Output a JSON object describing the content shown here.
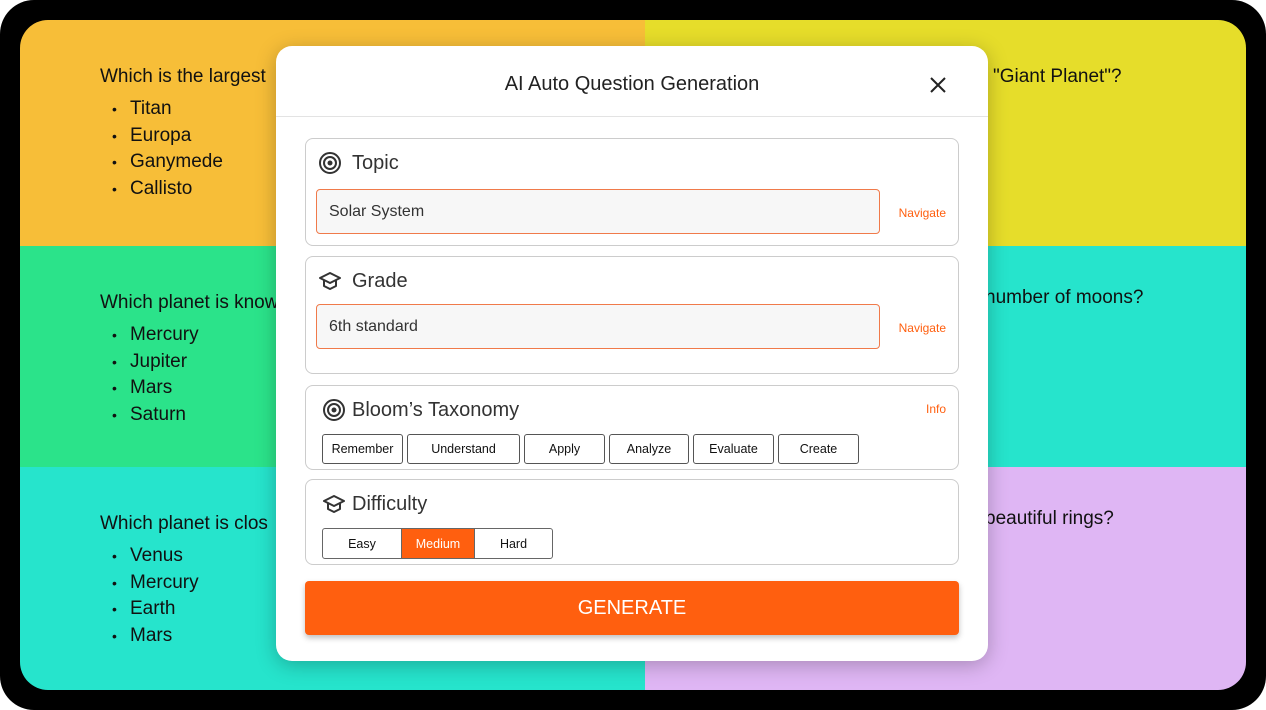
{
  "background_questions": [
    {
      "question": "Which is the largest",
      "options": [
        "Titan",
        "Europa",
        "Ganymede",
        "Callisto"
      ],
      "color": "#F7BE38"
    },
    {
      "question": "\"Giant Planet\"?",
      "options": [],
      "color": "#E6DD2A"
    },
    {
      "question": "Which planet is know",
      "options": [
        "Mercury",
        "Jupiter",
        "Mars",
        "Saturn"
      ],
      "color": "#2BE38A"
    },
    {
      "question": "number of moons?",
      "options": [],
      "color": "#26E4CC"
    },
    {
      "question": "Which planet is clos",
      "options": [
        "Venus",
        "Mercury",
        "Earth",
        "Mars"
      ],
      "color": "#26E4CC"
    },
    {
      "question": "beautiful rings?",
      "options": [],
      "color": "#DFB6F4"
    }
  ],
  "modal": {
    "title": "AI Auto Question Generation",
    "close_icon": "close-icon",
    "topic": {
      "label": "Topic",
      "value": "Solar System",
      "link": "Navigate"
    },
    "grade": {
      "label": "Grade",
      "value": "6th standard",
      "link": "Navigate"
    },
    "bloom": {
      "label": "Bloom’s Taxonomy",
      "info": "Info",
      "options": [
        "Remember",
        "Understand",
        "Apply",
        "Analyze",
        "Evaluate",
        "Create"
      ]
    },
    "difficulty": {
      "label": "Difficulty",
      "options": [
        "Easy",
        "Medium",
        "Hard"
      ],
      "selected": "Medium"
    },
    "generate": "GENERATE"
  },
  "accent": "#FF5F0F"
}
